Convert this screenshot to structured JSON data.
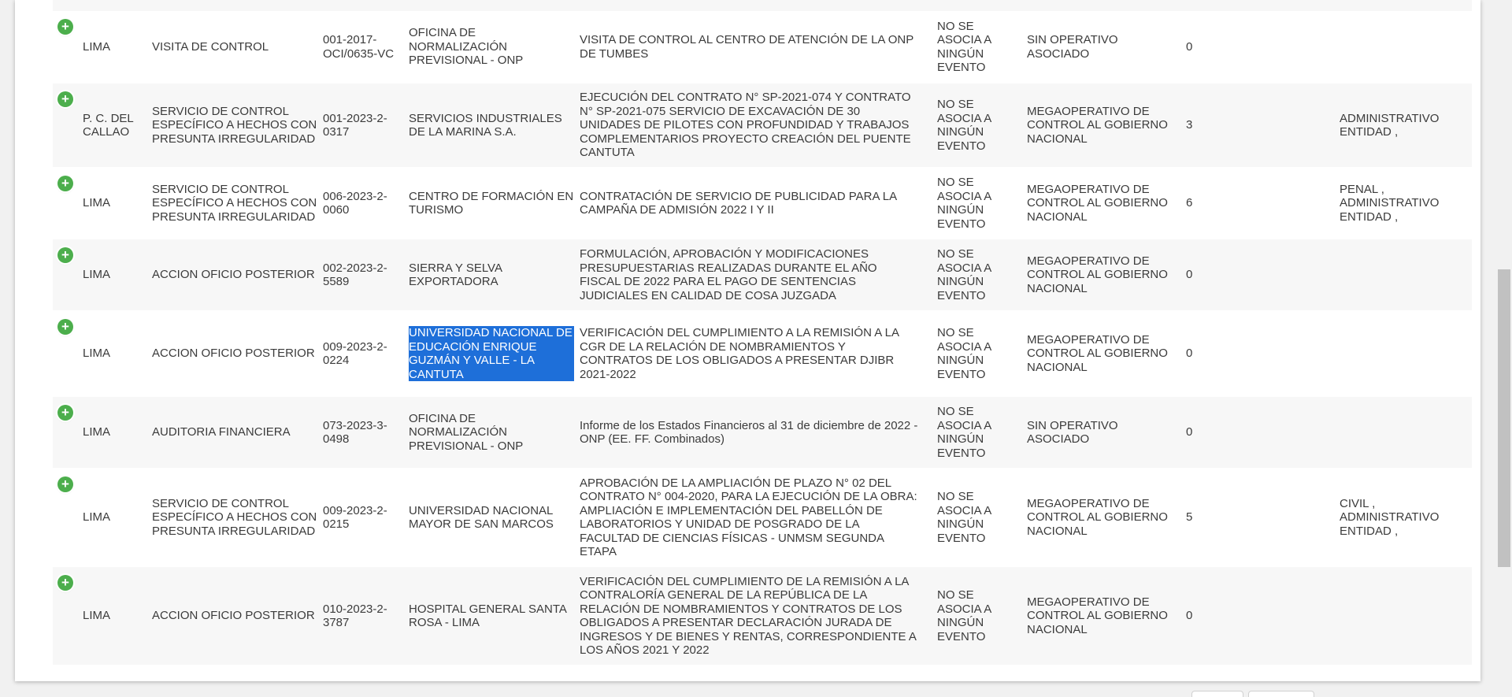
{
  "rows": [
    {
      "region": "LIMA",
      "type": "VISITA DE CONTROL",
      "code": "001-2017-OCI/0635-VC",
      "entity": "OFICINA DE NORMALIZACIÓN PREVISIONAL - ONP",
      "description": "VISITA DE CONTROL AL CENTRO DE ATENCIÓN DE LA ONP DE TUMBES",
      "event": "NO SE ASOCIA A NINGÚN EVENTO",
      "operative": "SIN OPERATIVO ASOCIADO",
      "count": "0",
      "responsibility": ""
    },
    {
      "region": "P. C. DEL CALLAO",
      "type": "SERVICIO DE CONTROL ESPECÍFICO A HECHOS CON PRESUNTA IRREGULARIDAD",
      "code": "001-2023-2-0317",
      "entity": "SERVICIOS INDUSTRIALES DE LA MARINA S.A.",
      "description": "EJECUCIÓN DEL CONTRATO N° SP-2021-074 Y CONTRATO N° SP-2021-075 SERVICIO DE EXCAVACIÓN DE 30 UNIDADES DE PILOTES CON PROFUNDIDAD Y TRABAJOS COMPLEMENTARIOS PROYECTO CREACIÓN DEL PUENTE CANTUTA",
      "event": "NO SE ASOCIA A NINGÚN EVENTO",
      "operative": "MEGAOPERATIVO DE CONTROL AL GOBIERNO NACIONAL",
      "count": "3",
      "responsibility": "ADMINISTRATIVO ENTIDAD ,"
    },
    {
      "region": "LIMA",
      "type": "SERVICIO DE CONTROL ESPECÍFICO A HECHOS CON PRESUNTA IRREGULARIDAD",
      "code": "006-2023-2-0060",
      "entity": "CENTRO DE FORMACIÓN EN TURISMO",
      "description": "CONTRATACIÓN DE SERVICIO DE PUBLICIDAD PARA LA CAMPAÑA DE ADMISIÓN 2022 I Y II",
      "event": "NO SE ASOCIA A NINGÚN EVENTO",
      "operative": "MEGAOPERATIVO DE CONTROL AL GOBIERNO NACIONAL",
      "count": "6",
      "responsibility": "PENAL , ADMINISTRATIVO ENTIDAD ,"
    },
    {
      "region": "LIMA",
      "type": "ACCION OFICIO POSTERIOR",
      "code": "002-2023-2-5589",
      "entity": "SIERRA Y SELVA EXPORTADORA",
      "description": "FORMULACIÓN, APROBACIÓN Y MODIFICACIONES PRESUPUESTARIAS REALIZADAS DURANTE EL AÑO FISCAL DE 2022 PARA EL PAGO DE SENTENCIAS JUDICIALES EN CALIDAD DE COSA JUZGADA",
      "event": "NO SE ASOCIA A NINGÚN EVENTO",
      "operative": "MEGAOPERATIVO DE CONTROL AL GOBIERNO NACIONAL",
      "count": "0",
      "responsibility": ""
    },
    {
      "region": "LIMA",
      "type": "ACCION OFICIO POSTERIOR",
      "code": "009-2023-2-0224",
      "entity": "UNIVERSIDAD NACIONAL DE EDUCACIÓN ENRIQUE GUZMÁN Y VALLE - LA CANTUTA",
      "description": "VERIFICACIÓN DEL CUMPLIMIENTO A LA REMISIÓN A LA CGR DE LA RELACIÓN DE NOMBRAMIENTOS Y CONTRATOS DE LOS OBLIGADOS A PRESENTAR DJIBR 2021-2022",
      "event": "NO SE ASOCIA A NINGÚN EVENTO",
      "operative": "MEGAOPERATIVO DE CONTROL AL GOBIERNO NACIONAL",
      "count": "0",
      "responsibility": ""
    },
    {
      "region": "LIMA",
      "type": "AUDITORIA FINANCIERA",
      "code": "073-2023-3-0498",
      "entity": "OFICINA DE NORMALIZACIÓN PREVISIONAL - ONP",
      "description": "Informe de los Estados Financieros al 31 de diciembre de 2022 - ONP (EE. FF. Combinados)",
      "event": "NO SE ASOCIA A NINGÚN EVENTO",
      "operative": "SIN OPERATIVO ASOCIADO",
      "count": "0",
      "responsibility": ""
    },
    {
      "region": "LIMA",
      "type": "SERVICIO DE CONTROL ESPECÍFICO A HECHOS CON PRESUNTA IRREGULARIDAD",
      "code": "009-2023-2-0215",
      "entity": "UNIVERSIDAD NACIONAL MAYOR DE SAN MARCOS",
      "description": "APROBACIÓN DE LA AMPLIACIÓN DE PLAZO N° 02 DEL CONTRATO N° 004-2020, PARA LA EJECUCIÓN DE LA OBRA: AMPLIACIÓN E IMPLEMENTACIÓN DEL PABELLÓN DE LABORATORIOS Y UNIDAD DE POSGRADO DE LA FACULTAD DE CIENCIAS FÍSICAS - UNMSM SEGUNDA ETAPA",
      "event": "NO SE ASOCIA A NINGÚN EVENTO",
      "operative": "MEGAOPERATIVO DE CONTROL AL GOBIERNO NACIONAL",
      "count": "5",
      "responsibility": "CIVIL , ADMINISTRATIVO ENTIDAD ,"
    },
    {
      "region": "LIMA",
      "type": "ACCION OFICIO POSTERIOR",
      "code": "010-2023-2-3787",
      "entity": "HOSPITAL GENERAL SANTA ROSA - LIMA",
      "description": "VERIFICACIÓN DEL CUMPLIMIENTO DE LA REMISIÓN A LA CONTRALORÍA GENERAL DE LA REPÚBLICA DE LA RELACIÓN DE NOMBRAMIENTOS Y CONTRATOS DE LOS OBLIGADOS A PRESENTAR DECLARACIÓN JURADA DE INGRESOS Y DE BIENES Y RENTAS, CORRESPONDIENTE A LOS AÑOS 2021 Y 2022",
      "event": "NO SE ASOCIA A NINGÚN EVENTO",
      "operative": "MEGAOPERATIVO DE CONTROL AL GOBIERNO NACIONAL",
      "count": "0",
      "responsibility": ""
    }
  ],
  "expand_icon": "plus-circle-icon",
  "colors": {
    "expand_green": "#4cae4c",
    "selection_blue": "#1e6fd9",
    "row_stripe": "#f7f7f7"
  }
}
